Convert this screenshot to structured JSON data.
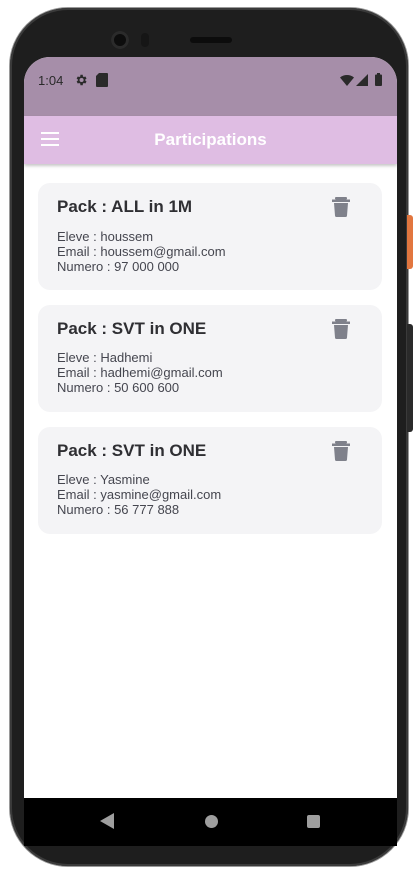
{
  "status_bar": {
    "time": "1:04",
    "icons": [
      "gear-icon",
      "sd-card-icon",
      "wifi-icon",
      "signal-icon",
      "battery-icon"
    ]
  },
  "app_bar": {
    "title": "Participations",
    "menu_icon": "menu-icon"
  },
  "participations": [
    {
      "title": "Pack : ALL in 1M",
      "eleve": "Eleve : houssem",
      "email": "Email : houssem@gmail.com",
      "numero": "Numero : 97 000 000"
    },
    {
      "title": "Pack : SVT in ONE",
      "eleve": "Eleve : Hadhemi",
      "email": "Email : hadhemi@gmail.com",
      "numero": "Numero : 50 600 600"
    },
    {
      "title": "Pack : SVT in ONE",
      "eleve": "Eleve : Yasmine",
      "email": "Email : yasmine@gmail.com",
      "numero": "Numero : 56 777 888"
    }
  ],
  "colors": {
    "status_bar": "#a68ea9",
    "app_bar": "#dfbde3",
    "card": "#f4f4f6",
    "icon_grey": "#7f818b"
  },
  "nav_bar": {
    "icons": [
      "back-icon",
      "home-icon",
      "recents-icon"
    ]
  }
}
